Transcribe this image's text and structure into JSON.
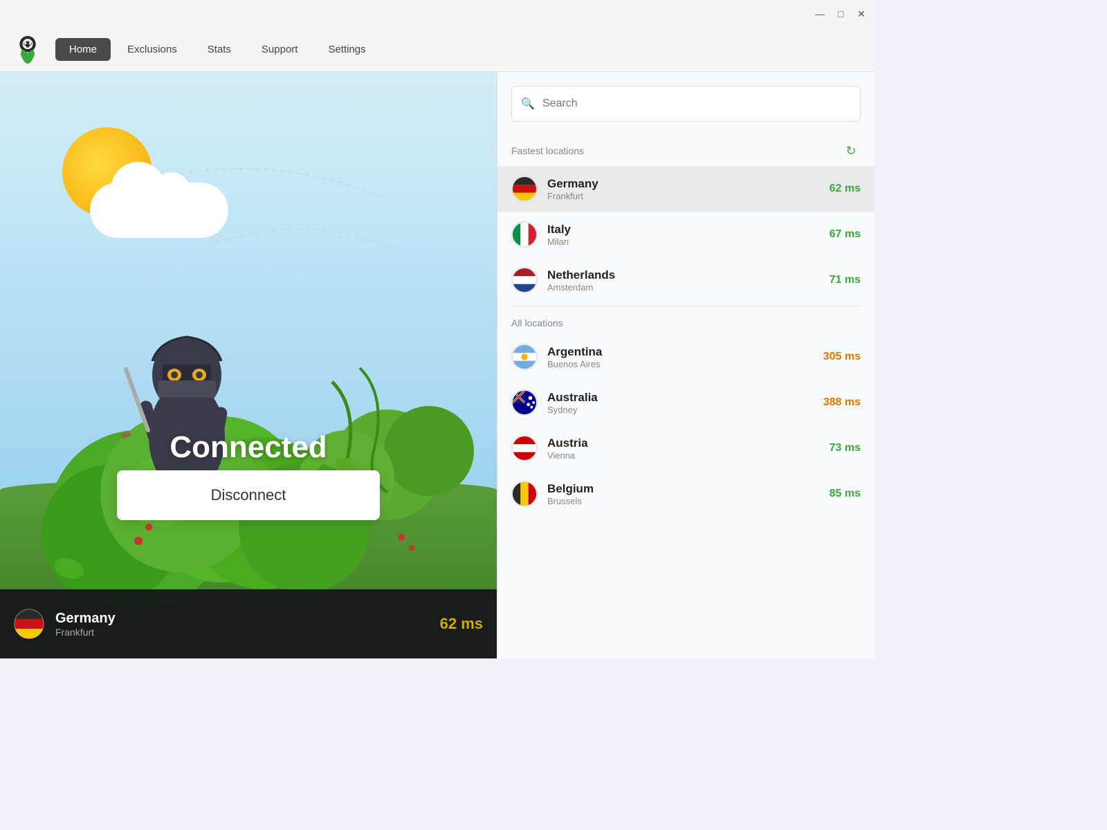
{
  "titlebar": {
    "minimize_label": "—",
    "maximize_label": "□",
    "close_label": "✕"
  },
  "navbar": {
    "logo_alt": "NordVPN Logo",
    "items": [
      {
        "id": "home",
        "label": "Home",
        "active": true
      },
      {
        "id": "exclusions",
        "label": "Exclusions",
        "active": false
      },
      {
        "id": "stats",
        "label": "Stats",
        "active": false
      },
      {
        "id": "support",
        "label": "Support",
        "active": false
      },
      {
        "id": "settings",
        "label": "Settings",
        "active": false
      }
    ]
  },
  "left_panel": {
    "status": "Connected",
    "disconnect_label": "Disconnect",
    "current_location": {
      "country": "Germany",
      "city": "Frankfurt",
      "latency": "62 ms"
    }
  },
  "right_panel": {
    "search": {
      "placeholder": "Search"
    },
    "fastest_locations": {
      "section_title": "Fastest locations",
      "items": [
        {
          "country": "Germany",
          "city": "Frankfurt",
          "latency": "62 ms",
          "flag": "🇩🇪",
          "ms_class": "ms-green",
          "selected": true
        },
        {
          "country": "Italy",
          "city": "Milan",
          "latency": "67 ms",
          "flag": "🇮🇹",
          "ms_class": "ms-green",
          "selected": false
        },
        {
          "country": "Netherlands",
          "city": "Amsterdam",
          "latency": "71 ms",
          "flag": "🇳🇱",
          "ms_class": "ms-green",
          "selected": false
        }
      ]
    },
    "all_locations": {
      "section_title": "All locations",
      "items": [
        {
          "country": "Argentina",
          "city": "Buenos Aires",
          "latency": "305 ms",
          "flag": "🇦🇷",
          "ms_class": "ms-orange",
          "selected": false
        },
        {
          "country": "Australia",
          "city": "Sydney",
          "latency": "388 ms",
          "flag": "🇦🇺",
          "ms_class": "ms-orange",
          "selected": false
        },
        {
          "country": "Austria",
          "city": "Vienna",
          "latency": "73 ms",
          "flag": "🇦🇹",
          "ms_class": "ms-green",
          "selected": false
        },
        {
          "country": "Belgium",
          "city": "Brussels",
          "latency": "85 ms",
          "flag": "🇧🇪",
          "ms_class": "ms-green",
          "selected": false
        }
      ]
    }
  }
}
